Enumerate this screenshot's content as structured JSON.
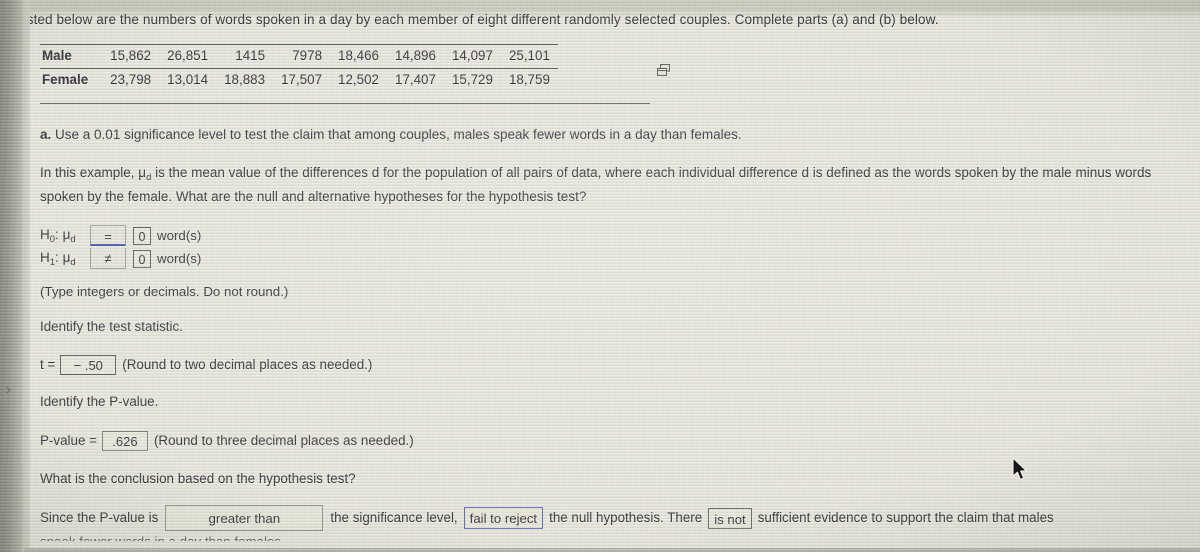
{
  "prompt": "Listed below are the numbers of words spoken in a day by each member of eight different randomly selected couples. Complete parts (a) and (b) below.",
  "table": {
    "rows": [
      {
        "label": "Male",
        "values": [
          "15,862",
          "26,851",
          "1415",
          "7978",
          "18,466",
          "14,896",
          "14,097",
          "25,101"
        ]
      },
      {
        "label": "Female",
        "values": [
          "23,798",
          "13,014",
          "18,883",
          "17,507",
          "12,502",
          "17,407",
          "15,729",
          "18,759"
        ]
      }
    ],
    "copy_icon": "copy-to-clipboard-icon"
  },
  "part_a": {
    "marker": "a.",
    "text": "Use a 0.01 significance level to test the claim that among couples, males speak fewer words in a day than females."
  },
  "paragraph": "In this example, μd is the mean value of the differences d for the population of all pairs of data, where each individual difference d is defined as the words spoken by the male minus words spoken by the female. What are the null and alternative hypotheses for the hypothesis test?",
  "paragraph_parts": {
    "before_mu": "In this example, ",
    "mu": "μ",
    "mu_sub": "d",
    "after_mu": " is the mean value of the differences d for the population of all pairs of data, where each individual difference d is defined as the words spoken by the male minus words spoken by the female. What are the null and alternative hypotheses for the hypothesis test?"
  },
  "hypotheses": {
    "null": {
      "label": "H",
      "label_sub": "0",
      "param": "μ",
      "param_sub": "d",
      "operator": "=",
      "value": "0",
      "unit": "word(s)"
    },
    "alt": {
      "label": "H",
      "label_sub": "1",
      "param": "μ",
      "param_sub": "d",
      "operator": "≠",
      "value": "0",
      "unit": "word(s)"
    },
    "note": "(Type integers or decimals. Do not round.)",
    "active_border_color": "#3b52b0"
  },
  "test_statistic": {
    "instruction": "Identify the test statistic.",
    "label": "t =",
    "value": "− .50",
    "hint": "(Round to two decimal places as needed.)"
  },
  "p_value": {
    "instruction": "Identify the P-value.",
    "label": "P-value =",
    "value": ".626",
    "hint": "(Round to three decimal places as needed.)"
  },
  "conclusion": {
    "question": "What is the conclusion based on the hypothesis test?",
    "text_1": "Since the P-value is",
    "dropdown_1": "greater than",
    "text_2": "the significance level,",
    "dropdown_2": "fail to reject",
    "text_3": "the null hypothesis. There",
    "dropdown_3": "is not",
    "text_4": "sufficient evidence to support the claim that males",
    "text_5": "speak fewer words in a day than females."
  },
  "nav": {
    "next_chevron": "›"
  },
  "colors": {
    "page_background": "#ebe9e0",
    "text": "#27272b",
    "accent_blue": "#4a5cb4",
    "rule": "#55564e"
  }
}
